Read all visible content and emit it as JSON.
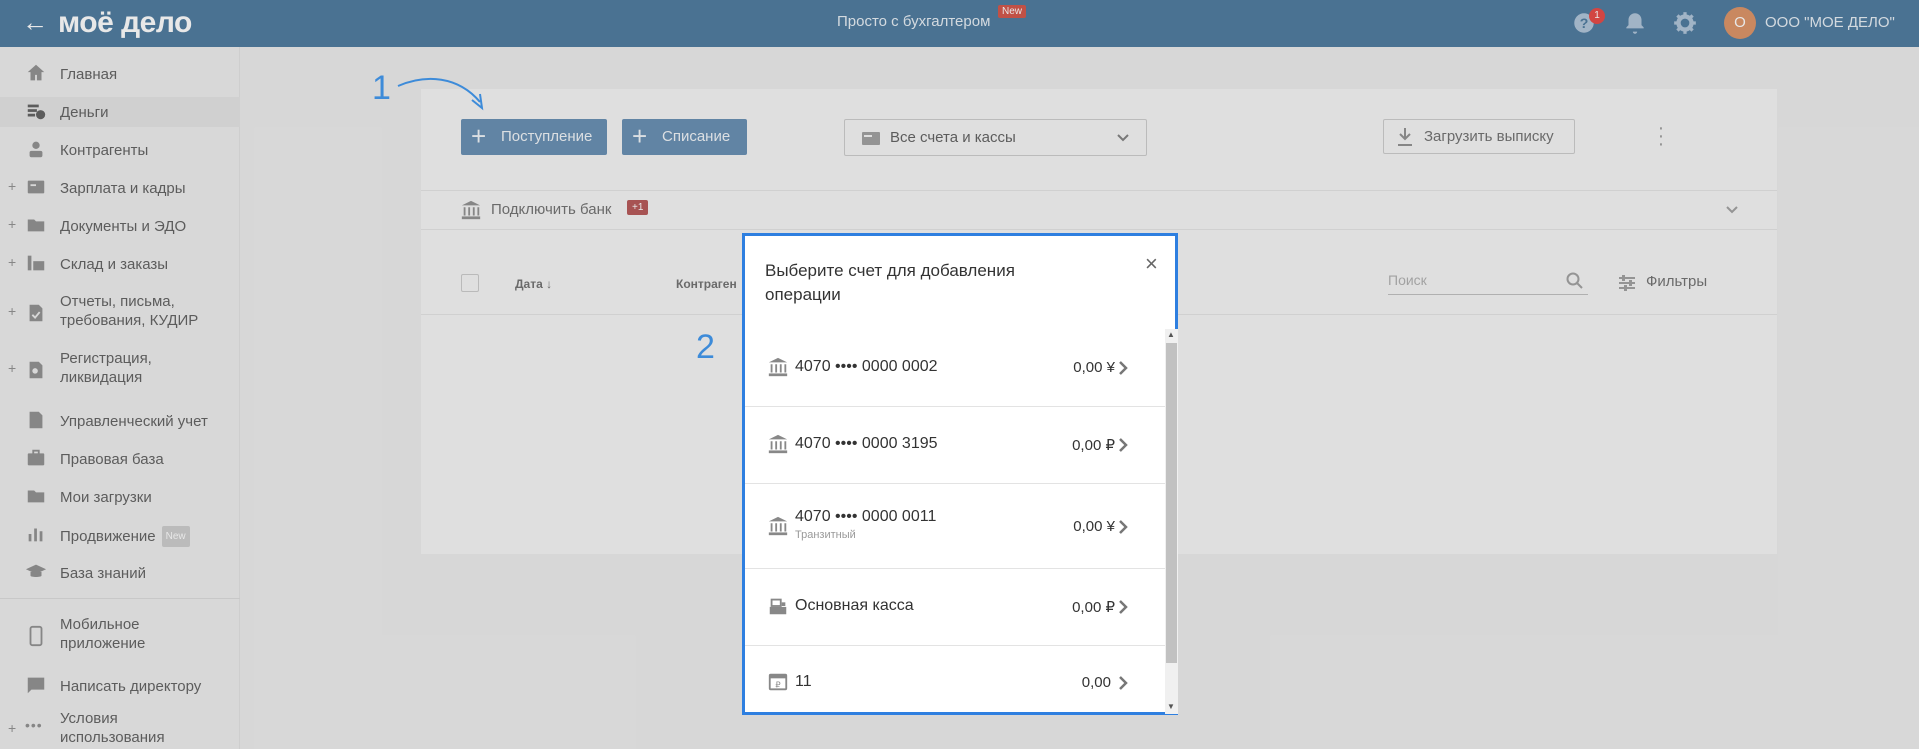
{
  "header": {
    "logo": "моё дело",
    "center_title": "Просто с бухгалтером",
    "new_badge": "New",
    "help_badge": "1",
    "avatar_letter": "О",
    "org_name": "ООО \"МОЕ ДЕЛО\""
  },
  "sidebar": {
    "items": [
      {
        "label": "Главная",
        "icon": "home-icon"
      },
      {
        "label": "Деньги",
        "icon": "money-icon"
      },
      {
        "label": "Контрагенты",
        "icon": "contractors-icon"
      },
      {
        "label": "Зарплата и кадры",
        "icon": "salary-icon"
      },
      {
        "label": "Документы и ЭДО",
        "icon": "folder-icon"
      },
      {
        "label": "Склад и заказы",
        "icon": "warehouse-icon"
      },
      {
        "label": "Отчеты, письма, требования, КУДИР",
        "icon": "reports-icon"
      },
      {
        "label": "Регистрация, ликвидация",
        "icon": "registration-icon"
      },
      {
        "label": "Управленческий учет",
        "icon": "management-icon"
      },
      {
        "label": "Правовая база",
        "icon": "briefcase-icon"
      },
      {
        "label": "Мои загрузки",
        "icon": "folder-icon"
      },
      {
        "label": "Продвижение",
        "icon": "promotion-icon",
        "badge": "New"
      },
      {
        "label": "База знаний",
        "icon": "graduation-icon"
      },
      {
        "label": "Мобильное приложение",
        "icon": "mobile-icon"
      },
      {
        "label": "Написать директору",
        "icon": "chat-icon"
      },
      {
        "label": "Условия использования",
        "icon": "more-icon"
      }
    ]
  },
  "toolbar": {
    "income_label": "Поступление",
    "expense_label": "Списание",
    "accounts_select": "Все счета и кассы",
    "upload_label": "Загрузить выписку"
  },
  "bank": {
    "connect_label": "Подключить банк",
    "badge": "+1"
  },
  "table": {
    "col_date": "Дата ↓",
    "col_contractor": "Контраген",
    "search_placeholder": "Поиск",
    "filters_label": "Фильтры"
  },
  "annotations": {
    "one": "1",
    "two": "2"
  },
  "modal": {
    "title": "Выберите счет для добавления операции",
    "accounts": [
      {
        "name": "4070 •••• 0000 0002",
        "sub": "",
        "amount": "0,00 ¥",
        "icon": "bank-icon"
      },
      {
        "name": "4070 •••• 0000 3195",
        "sub": "",
        "amount": "0,00 ₽",
        "icon": "bank-icon"
      },
      {
        "name": "4070 •••• 0000 0011",
        "sub": "Транзитный",
        "amount": "0,00 ¥",
        "icon": "bank-icon"
      },
      {
        "name": "Основная касса",
        "sub": "",
        "amount": "0,00 ₽",
        "icon": "cash-register-icon"
      },
      {
        "name": "11",
        "sub": "",
        "amount": "0,00",
        "icon": "wallet-icon"
      }
    ]
  }
}
